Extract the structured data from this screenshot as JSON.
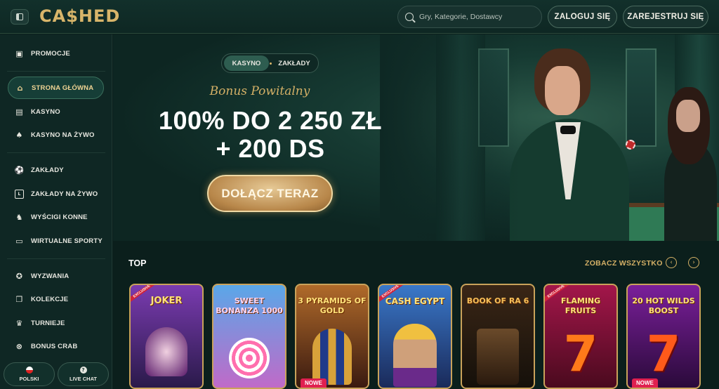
{
  "header": {
    "logo": "CA$HED",
    "search_placeholder": "Gry, Kategorie, Dostawcy",
    "login_label": "ZALOGUJ SIĘ",
    "register_label": "ZAREJESTRUJ SIĘ"
  },
  "sidebar": {
    "items": [
      {
        "label": "PROMOCJE",
        "icon": "gift-icon"
      },
      {
        "label": "STRONA GŁÓWNA",
        "icon": "home-icon",
        "active": true
      },
      {
        "label": "KASYNO",
        "icon": "slot-machine-icon"
      },
      {
        "label": "KASYNO NA ŻYWO",
        "icon": "cards-icon"
      },
      {
        "label": "ZAKŁADY",
        "icon": "ball-icon"
      },
      {
        "label": "ZAKŁADY NA ŻYWO",
        "icon": "live-icon"
      },
      {
        "label": "WYŚCIGI KONNE",
        "icon": "horse-icon"
      },
      {
        "label": "WIRTUALNE SPORTY",
        "icon": "virtual-icon"
      },
      {
        "label": "WYZWANIA",
        "icon": "challenge-icon"
      },
      {
        "label": "KOLEKCJE",
        "icon": "collection-icon"
      },
      {
        "label": "TURNIEJE",
        "icon": "trophy-icon"
      },
      {
        "label": "BONUS CRAB",
        "icon": "claw-icon"
      }
    ],
    "language_label": "POLSKI",
    "chat_label": "LIVE CHAT"
  },
  "hero": {
    "tabs": [
      "KASYNO",
      "ZAKŁADY"
    ],
    "active_tab": "KASYNO",
    "subtitle": "Bonus Powitalny",
    "title_line1": "100% DO 2 250 ZŁ",
    "title_line2": "+ 200 DS",
    "cta_label": "DOŁĄCZ TERAZ"
  },
  "top_section": {
    "title": "TOP",
    "see_all": "ZOBACZ WSZYSTKO",
    "games": [
      {
        "title": "JOKER",
        "badge": "",
        "excl": "EXCLUSIVE",
        "bg": "#7a3bb0"
      },
      {
        "title": "SWEET BONANZA 1000",
        "badge": "",
        "excl": "",
        "bg": "#5aa7e8"
      },
      {
        "title": "3 PYRAMIDS OF GOLD",
        "badge": "NOWE",
        "excl": "",
        "bg": "#6a2a1c"
      },
      {
        "title": "CASH EGYPT",
        "badge": "",
        "excl": "EXCLUSIVE",
        "bg": "#3a78c9"
      },
      {
        "title": "BOOK OF RA 6",
        "badge": "",
        "excl": "",
        "bg": "#3a2616"
      },
      {
        "title": "FLAMING FRUITS",
        "badge": "",
        "excl": "EXCLUSIVE",
        "bg": "#a3164a"
      },
      {
        "title": "20 HOT WILDS BOOST",
        "badge": "NOWE",
        "excl": "",
        "bg": "#7a1f9a"
      }
    ]
  },
  "colors": {
    "accent_gold": "#d4b066",
    "background": "#0b1f1c",
    "badge_new": "#e02050"
  }
}
